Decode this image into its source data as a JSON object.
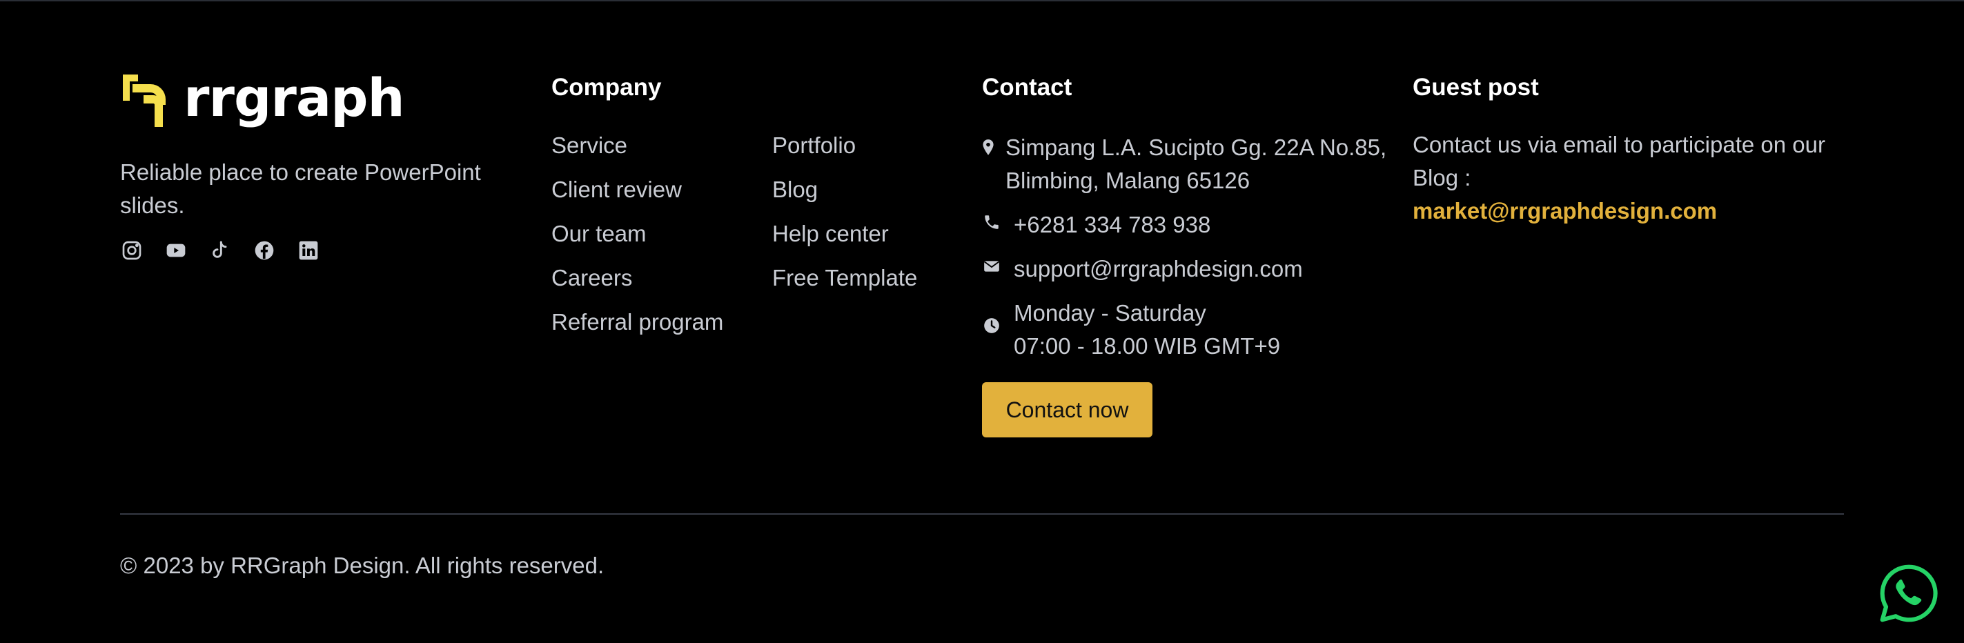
{
  "brand": {
    "logo_text": "rrgraph",
    "tagline": "Reliable place to create PowerPoint slides.",
    "socials": [
      {
        "name": "instagram-icon"
      },
      {
        "name": "youtube-icon"
      },
      {
        "name": "tiktok-icon"
      },
      {
        "name": "facebook-icon"
      },
      {
        "name": "linkedin-icon"
      }
    ]
  },
  "company": {
    "title": "Company",
    "col1": [
      "Service",
      "Client review",
      "Our team",
      "Careers",
      "Referral program"
    ],
    "col2": [
      "Portfolio",
      "Blog",
      "Help center",
      "Free Template"
    ]
  },
  "contact": {
    "title": "Contact",
    "address_line1": "Simpang L.A. Sucipto Gg. 22A No.85,",
    "address_line2": "Blimbing, Malang 65126",
    "phone": "+6281 334 783 938",
    "email": "support@rrgraphdesign.com",
    "hours_days": "Monday - Saturday",
    "hours_time": "07:00 - 18.00 WIB GMT+9",
    "button": "Contact now"
  },
  "guest": {
    "title": "Guest post",
    "text": "Contact us via email to participate on our Blog :",
    "email": "market@rrgraphdesign.com"
  },
  "copyright": "© 2023 by RRGraph Design. All rights reserved.",
  "colors": {
    "accent": "#e2b13c",
    "logo_accent": "#f5df4d",
    "background": "#000000",
    "whatsapp": "#25d366"
  }
}
